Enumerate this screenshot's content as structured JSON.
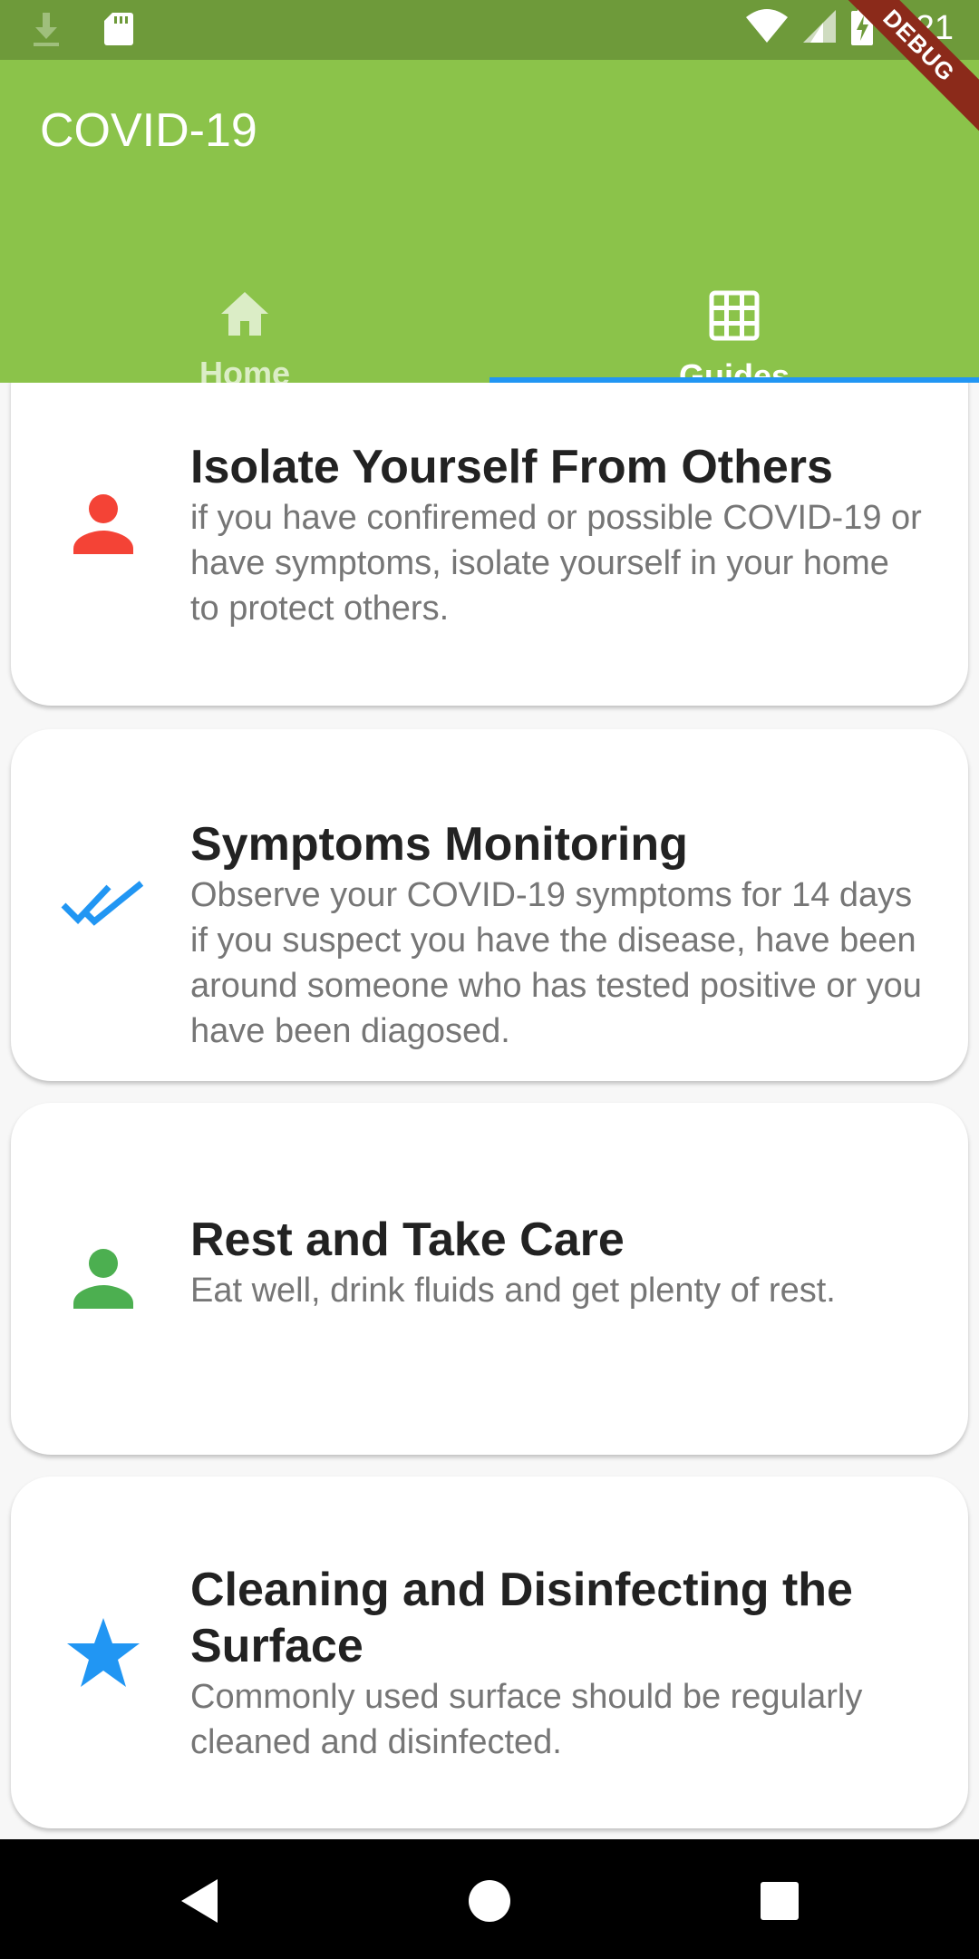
{
  "status_bar": {
    "time": "8:21",
    "icons": [
      "download-icon",
      "sd-card-icon",
      "wifi-icon",
      "signal-icon",
      "battery-charging-icon"
    ],
    "debug_label": "DEBUG"
  },
  "app_bar": {
    "title": "COVID-19",
    "background": "#8bc34a",
    "tabs": [
      {
        "label": "Home",
        "icon": "home-icon",
        "selected": false
      },
      {
        "label": "Guides",
        "icon": "grid-icon",
        "selected": true
      }
    ],
    "indicator_color": "#2196f3"
  },
  "guides": [
    {
      "title": "Isolate Yourself From Others",
      "description": "if you have confiremed or possible COVID-19 or have symptoms, isolate yourself in your home to protect others.",
      "icon": "person-icon",
      "icon_color": "#f44336"
    },
    {
      "title": "Symptoms Monitoring",
      "description": "Observe your COVID-19 symptoms for 14 days if you suspect you have the disease, have been around someone who has tested positive or you have been diagosed.",
      "icon": "double-check-icon",
      "icon_color": "#2196f3"
    },
    {
      "title": "Rest and Take Care",
      "description": "Eat well, drink fluids and get plenty of rest.",
      "icon": "person-icon",
      "icon_color": "#4caf50"
    },
    {
      "title": "Cleaning and Disinfecting the Surface",
      "description": "Commonly used surface should be regularly cleaned and disinfected.",
      "icon": "star-icon",
      "icon_color": "#2196f3"
    }
  ],
  "nav_bar": {
    "buttons": [
      "back-icon",
      "home-circle-icon",
      "recents-icon"
    ]
  }
}
